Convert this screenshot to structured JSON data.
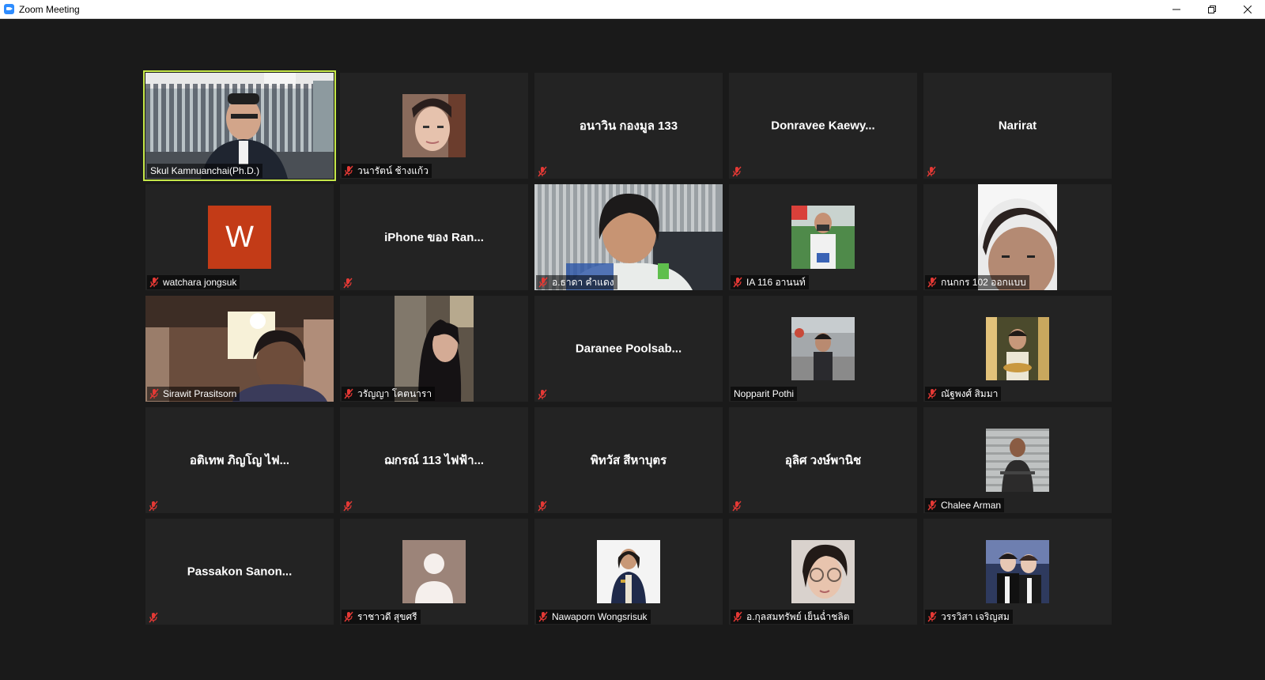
{
  "window": {
    "title": "Zoom Meeting"
  },
  "colors": {
    "active_speaker": "#c6e84a",
    "mute": "#d32f2f",
    "tile": "#232323"
  },
  "participants": [
    {
      "name": "Skul Kamnuanchai(Ph.D.)",
      "muted": false,
      "mode": "video"
    },
    {
      "name": "วนารัตน์ ช้างแก้ว",
      "muted": true,
      "mode": "photo"
    },
    {
      "name": "อนาวิน กองมูล 133",
      "muted": true,
      "mode": "name"
    },
    {
      "name": "Donravee Kaewy...",
      "muted": true,
      "mode": "name"
    },
    {
      "name": "Narirat",
      "muted": true,
      "mode": "name"
    },
    {
      "name": "watchara jongsuk",
      "muted": true,
      "mode": "letter",
      "letter": "W"
    },
    {
      "name": "iPhone ของ Ran...",
      "muted": true,
      "mode": "name"
    },
    {
      "name": "อ.ธาดา คำแดง",
      "muted": true,
      "mode": "video"
    },
    {
      "name": "IA 116 อานนท์",
      "muted": true,
      "mode": "photo"
    },
    {
      "name": "กนกกร 102 ออกแบบ",
      "muted": true,
      "mode": "photo"
    },
    {
      "name": "Sirawit Prasitsorn",
      "muted": true,
      "mode": "video"
    },
    {
      "name": "วรัญญา โคตนารา",
      "muted": true,
      "mode": "photo"
    },
    {
      "name": "Daranee Poolsab...",
      "muted": true,
      "mode": "name"
    },
    {
      "name": "Nopparit Pothi",
      "muted": false,
      "mode": "photo"
    },
    {
      "name": "ณัฐพงศ์ สิมมา",
      "muted": true,
      "mode": "photo"
    },
    {
      "name": "อติเทพ ภิญโญ ไฟ...",
      "muted": true,
      "mode": "name"
    },
    {
      "name": "ฌกรณ์ 113 ไฟฟ้า...",
      "muted": true,
      "mode": "name"
    },
    {
      "name": "พิทวัส สีหาบุตร",
      "muted": true,
      "mode": "name"
    },
    {
      "name": "อุลิศ วงษ์พานิช",
      "muted": true,
      "mode": "name"
    },
    {
      "name": "Chalee Arman",
      "muted": true,
      "mode": "photo"
    },
    {
      "name": "Passakon Sanon...",
      "muted": true,
      "mode": "name"
    },
    {
      "name": "ราชาวดี สุขศรี",
      "muted": true,
      "mode": "photo"
    },
    {
      "name": "Nawaporn Wongsrisuk",
      "muted": true,
      "mode": "photo"
    },
    {
      "name": "อ.กุลสมทรัพย์ เย็นฉ่ำชลิต",
      "muted": true,
      "mode": "photo"
    },
    {
      "name": "วรรวิสา เจริญสม",
      "muted": true,
      "mode": "photo"
    }
  ]
}
